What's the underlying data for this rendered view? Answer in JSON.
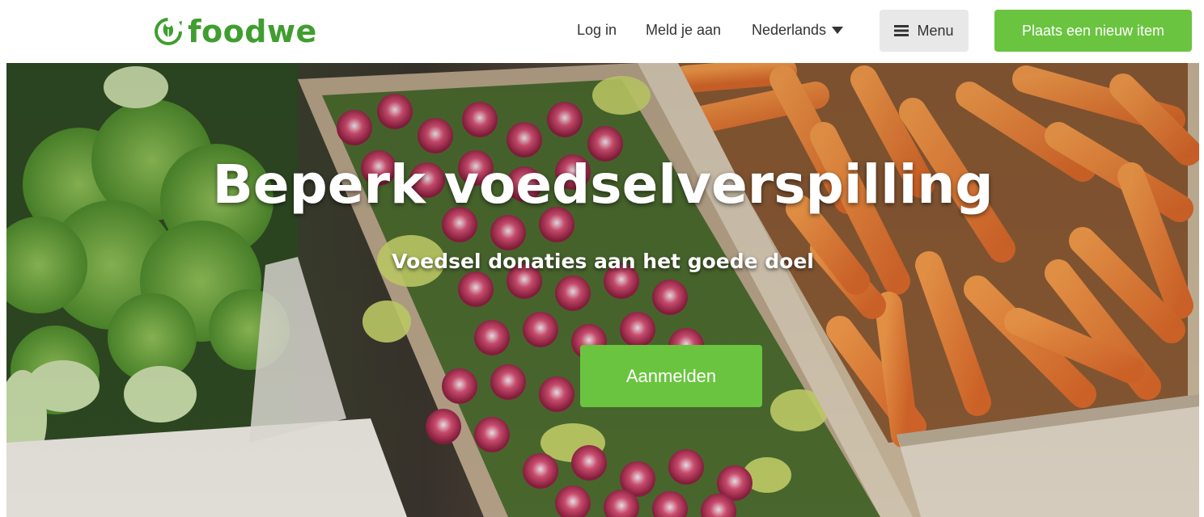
{
  "header": {
    "logo_text": "foodwe",
    "nav": {
      "login_label": "Log in",
      "signup_label": "Meld je aan",
      "language_label": "Nederlands"
    },
    "menu_label": "Menu",
    "post_item_label": "Plaats een nieuw item"
  },
  "hero": {
    "title": "Beperk voedselverspilling",
    "subtitle": "Voedsel donaties aan het goede doel",
    "cta_label": "Aanmelden",
    "image": "vegetable-market-crates-broccoli-radishes-carrots"
  },
  "colors": {
    "brand_green": "#3f9e2f",
    "button_green": "#6ac440",
    "menu_button_bg": "#e8e8e8",
    "nav_text": "#333333"
  },
  "icons": {
    "logo": "leaf-cycle-icon",
    "language": "caret-down-icon",
    "menu": "hamburger-icon"
  }
}
